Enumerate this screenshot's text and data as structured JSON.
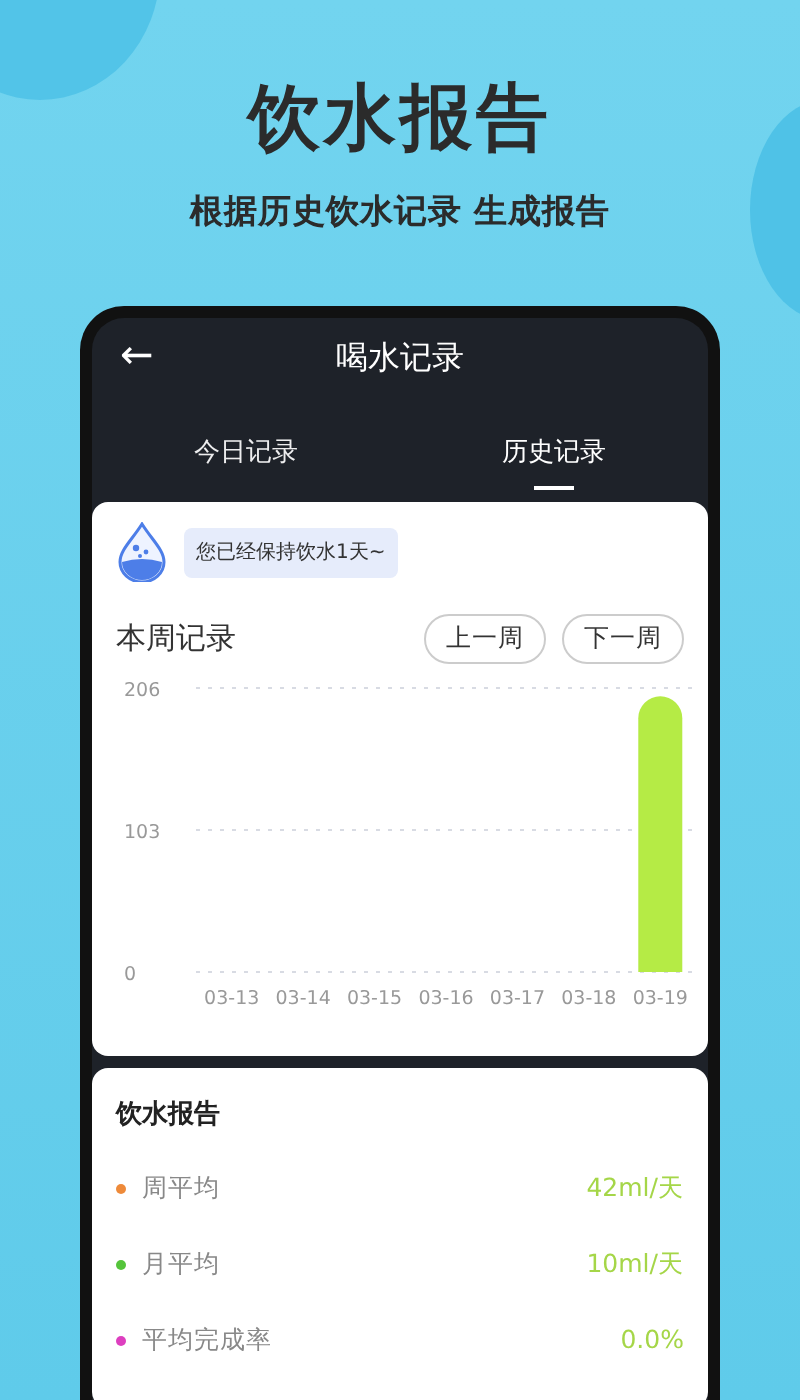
{
  "promo": {
    "title": "饮水报告",
    "subtitle": "根据历史饮水记录 生成报告"
  },
  "app": {
    "title": "喝水记录",
    "back": "←",
    "tabs": [
      {
        "label": "今日记录",
        "selected": false
      },
      {
        "label": "历史记录",
        "selected": true
      }
    ],
    "streak_message": "您已经保持饮水1天~",
    "week": {
      "title": "本周记录",
      "buttons": [
        "上一周",
        "下一周"
      ],
      "chart_data": {
        "type": "bar",
        "categories": [
          "03-13",
          "03-14",
          "03-15",
          "03-16",
          "03-17",
          "03-18",
          "03-19"
        ],
        "values": [
          0,
          0,
          0,
          0,
          0,
          0,
          200
        ],
        "ylim": [
          0,
          206
        ],
        "yticks": [
          0,
          103,
          206
        ]
      }
    },
    "report": {
      "title": "饮水报告",
      "rows": [
        {
          "label": "周平均",
          "value": "42ml/天",
          "color": "#ee8a3a"
        },
        {
          "label": "月平均",
          "value": "10ml/天",
          "color": "#55c43b"
        },
        {
          "label": "平均完成率",
          "value": "0.0%",
          "color": "#dd3fbf"
        }
      ]
    }
  }
}
